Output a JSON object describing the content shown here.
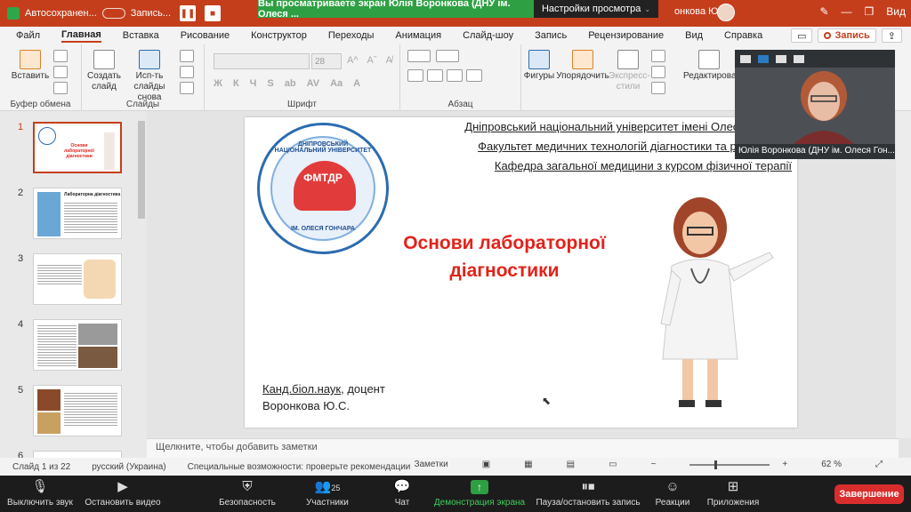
{
  "titlebar": {
    "autosave": "Автосохранен...",
    "recording": "Запись...",
    "share_banner": "Вы просматриваете экран Юлія Воронкова (ДНУ ім. Олеся ...",
    "view_settings": "Настройки просмотра",
    "view_settings_caret": "⌄",
    "user_name": "онкова Юлія",
    "view_label": "Вид"
  },
  "menu": {
    "items": [
      "Файл",
      "Главная",
      "Вставка",
      "Рисование",
      "Конструктор",
      "Переходы",
      "Анимация",
      "Слайд-шоу",
      "Запись",
      "Рецензирование",
      "Вид",
      "Справка"
    ],
    "record_button": "Запись"
  },
  "ribbon": {
    "groups": {
      "clipboard": "Буфер обмена",
      "slides": "Слайды",
      "font": "Шрифт",
      "paragraph": "Абзац"
    },
    "buttons": {
      "paste": "Вставить",
      "new_slide": "Создать слайд",
      "reuse_slides": "Исп-ть слайды снова",
      "shapes": "Фигуры",
      "arrange": "Упорядочить",
      "quick_styles": "Экспресс-стили",
      "editing": "Редактирова"
    },
    "font_size": "28",
    "format_buttons": [
      "Ж",
      "К",
      "Ч",
      "S",
      "ab",
      "AV",
      "Aa",
      "A"
    ],
    "size_buttons": [
      "A^",
      "Aˇ",
      "A̸"
    ]
  },
  "thumbnails": {
    "numbers": [
      "1",
      "2",
      "3",
      "4",
      "5",
      "6"
    ],
    "selected": "1",
    "slide1_title": "Основи лабораторної діагностики",
    "slide2_title": "Лабораторна діагностика"
  },
  "slide": {
    "university_lines": [
      "Дніпровський національний університет імені Олеся Гончара",
      "Факультет медичних технологій діагностики та реабілітації",
      "Кафедра загальної медицини з курсом фізичної терапії"
    ],
    "logo_top": "ДНІПРОВСЬКИЙ НАЦІОНАЛЬНИЙ УНІВЕРСИТЕТ",
    "logo_center": "ФМТДР",
    "logo_bottom": "ІМ. ОЛЕСЯ ГОНЧАРА",
    "title_line1": "Основи лабораторної",
    "title_line2": "діагностики",
    "author_degree": "Канд.біол.наук",
    "author_position": ", доцент",
    "author_name": "Воронкова Ю.С."
  },
  "notes_placeholder": "Щелкните, чтобы добавить заметки",
  "status": {
    "slide_counter": "Слайд 1 из 22",
    "language": "русский (Украина)",
    "accessibility": "Специальные возможности: проверьте рекомендации",
    "notes_button": "Заметки",
    "zoom_percent": "62 %"
  },
  "video": {
    "participant_name": "Юлія Воронкова (ДНУ ім. Олеся Гон..."
  },
  "zoom_toolbar": {
    "mute": "Выключить звук",
    "stop_video": "Остановить видео",
    "security": "Безопасность",
    "participants": "Участники",
    "participants_count": "25",
    "chat": "Чат",
    "share_screen": "Демонстрация экрана",
    "pause_recording": "Пауза/остановить запись",
    "reactions": "Реакции",
    "apps": "Приложения",
    "end": "Завершение"
  },
  "colors": {
    "ppt_accent": "#c43e1c",
    "zoom_green": "#2ea043",
    "title_red": "#e2231a",
    "end_red": "#d92d2d"
  }
}
